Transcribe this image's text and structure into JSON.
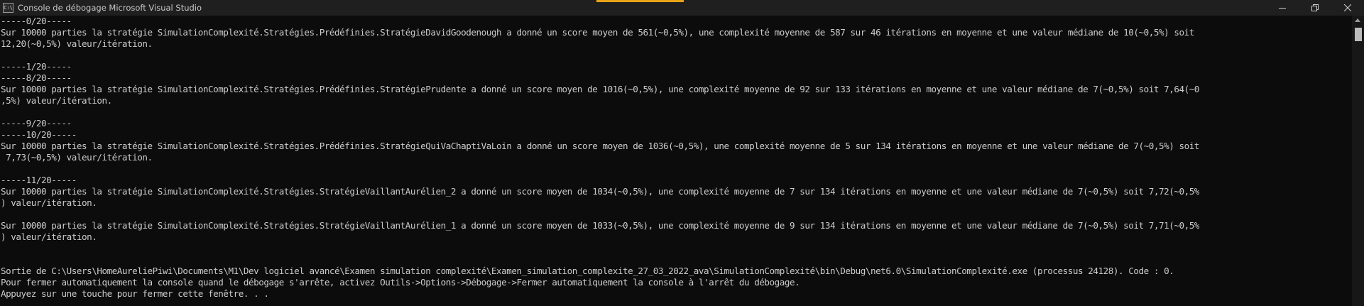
{
  "window": {
    "title": "Console de débogage Microsoft Visual Studio",
    "icon_text": "C:\\"
  },
  "console": {
    "lines": [
      "-----0/20-----",
      "Sur 10000 parties la stratégie SimulationComplexité.Stratégies.Prédéfinies.StratégieDavidGoodenough a donné un score moyen de 561(~0,5%), une complexité moyenne de 587 sur 46 itérations en moyenne et une valeur médiane de 10(~0,5%) soit",
      "12,20(~0,5%) valeur/itération.",
      "",
      "-----1/20-----",
      "-----8/20-----",
      "Sur 10000 parties la stratégie SimulationComplexité.Stratégies.Prédéfinies.StratégiePrudente a donné un score moyen de 1016(~0,5%), une complexité moyenne de 92 sur 133 itérations en moyenne et une valeur médiane de 7(~0,5%) soit 7,64(~0",
      ",5%) valeur/itération.",
      "",
      "-----9/20-----",
      "-----10/20-----",
      "Sur 10000 parties la stratégie SimulationComplexité.Stratégies.Prédéfinies.StratégieQuiVaChaptiVaLoin a donné un score moyen de 1036(~0,5%), une complexité moyenne de 5 sur 134 itérations en moyenne et une valeur médiane de 7(~0,5%) soit",
      " 7,73(~0,5%) valeur/itération.",
      "",
      "-----11/20-----",
      "Sur 10000 parties la stratégie SimulationComplexité.Stratégies.StratégieVaillantAurélien_2 a donné un score moyen de 1034(~0,5%), une complexité moyenne de 7 sur 134 itérations en moyenne et une valeur médiane de 7(~0,5%) soit 7,72(~0,5%",
      ") valeur/itération.",
      "",
      "Sur 10000 parties la stratégie SimulationComplexité.Stratégies.StratégieVaillantAurélien_1 a donné un score moyen de 1033(~0,5%), une complexité moyenne de 9 sur 134 itérations en moyenne et une valeur médiane de 7(~0,5%) soit 7,71(~0,5%",
      ") valeur/itération.",
      "",
      "",
      "Sortie de C:\\Users\\HomeAureliePiwi\\Documents\\M1\\Dev logiciel avancé\\Examen simulation complexité\\Examen_simulation_complexite_27_03_2022_ava\\SimulationComplexité\\bin\\Debug\\net6.0\\SimulationComplexité.exe (processus 24128). Code : 0.",
      "Pour fermer automatiquement la console quand le débogage s'arrête, activez Outils->Options->Débogage->Fermer automatiquement la console à l'arrêt du débogage.",
      "Appuyez sur une touche pour fermer cette fenêtre. . ."
    ]
  },
  "colors": {
    "background": "#0c0c0c",
    "text": "#cccccc",
    "titlebar": "#1f1f1f",
    "accent": "#e8a317"
  },
  "icons": {
    "app": "console-app-icon",
    "minimize": "minimize-icon",
    "restore": "restore-icon",
    "close": "close-icon"
  }
}
